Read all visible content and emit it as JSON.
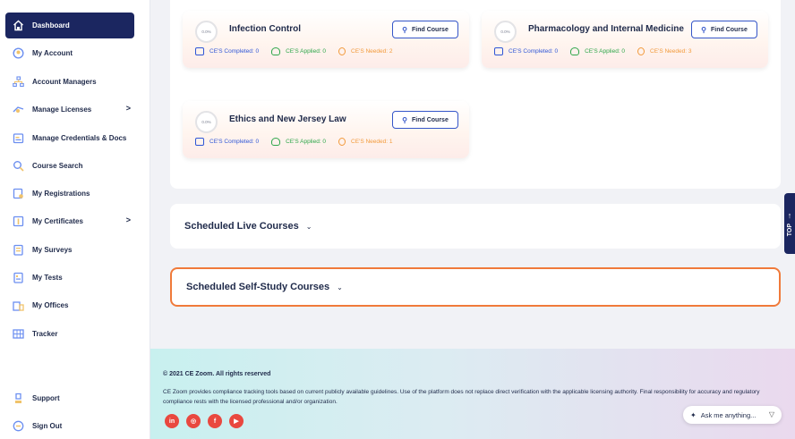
{
  "sidebar": {
    "items": [
      {
        "label": "Dashboard",
        "icon": "home-icon",
        "active": true
      },
      {
        "label": "My Account",
        "icon": "user-circle-icon"
      },
      {
        "label": "Account Managers",
        "icon": "org-chart-icon"
      },
      {
        "label": "Manage Licenses",
        "icon": "license-icon",
        "chevron": ">"
      },
      {
        "label": "Manage Credentials & Docs",
        "icon": "credentials-icon"
      },
      {
        "label": "Course Search",
        "icon": "search-icon"
      },
      {
        "label": "My Registrations",
        "icon": "registrations-icon"
      },
      {
        "label": "My Certificates",
        "icon": "certificate-icon",
        "chevron": ">"
      },
      {
        "label": "My Surveys",
        "icon": "survey-icon"
      },
      {
        "label": "My Tests",
        "icon": "test-icon"
      },
      {
        "label": "My Offices",
        "icon": "office-icon"
      },
      {
        "label": "Tracker",
        "icon": "tracker-icon"
      },
      {
        "label": "Support",
        "icon": "support-icon"
      },
      {
        "label": "Sign Out",
        "icon": "sign-out-icon"
      }
    ]
  },
  "courses": [
    {
      "progress": "0.0%",
      "title": "Infection Control",
      "button": "Find Course",
      "completed": "CE'S Completed: 0",
      "applied": "CE'S Applied: 0",
      "needed": "CE'S Needed: 2"
    },
    {
      "progress": "0.0%",
      "title": "Pharmacology and Internal Medicine",
      "button": "Find Course",
      "completed": "CE'S Completed: 0",
      "applied": "CE'S Applied: 0",
      "needed": "CE'S Needed: 3"
    },
    {
      "progress": "0.0%",
      "title": "Ethics and New Jersey Law",
      "button": "Find Course",
      "completed": "CE'S Completed: 0",
      "applied": "CE'S Applied: 0",
      "needed": "CE'S Needed: 1"
    }
  ],
  "sections": {
    "live": "Scheduled Live Courses",
    "self_study": "Scheduled Self-Study Courses",
    "chevron": "⌄"
  },
  "top_tab": {
    "label": "TOP",
    "arrow": "↑"
  },
  "footer": {
    "copyright": "© 2021 CE Zoom. All rights reserved",
    "disclaimer": "CE Zoom provides compliance tracking tools based on current publicly available guidelines. Use of the platform does not replace direct verification with the applicable licensing authority. Final responsibility for accuracy and regulatory compliance rests with the licensed professional and/or organization.",
    "socials": [
      {
        "icon": "linkedin-icon",
        "glyph": "in"
      },
      {
        "icon": "instagram-icon",
        "glyph": "◎"
      },
      {
        "icon": "facebook-icon",
        "glyph": "f"
      },
      {
        "icon": "youtube-icon",
        "glyph": "▶"
      }
    ],
    "ask": {
      "label": "Ask me anything...",
      "spark": "✦",
      "send": "▽"
    }
  },
  "colors": {
    "accent": "#1b2660",
    "link": "#3456c9",
    "selected_border": "#f07a3a",
    "completed": "#2f56d6",
    "applied": "#2ea64a",
    "needed": "#f29a3b",
    "social": "#e9483f"
  }
}
